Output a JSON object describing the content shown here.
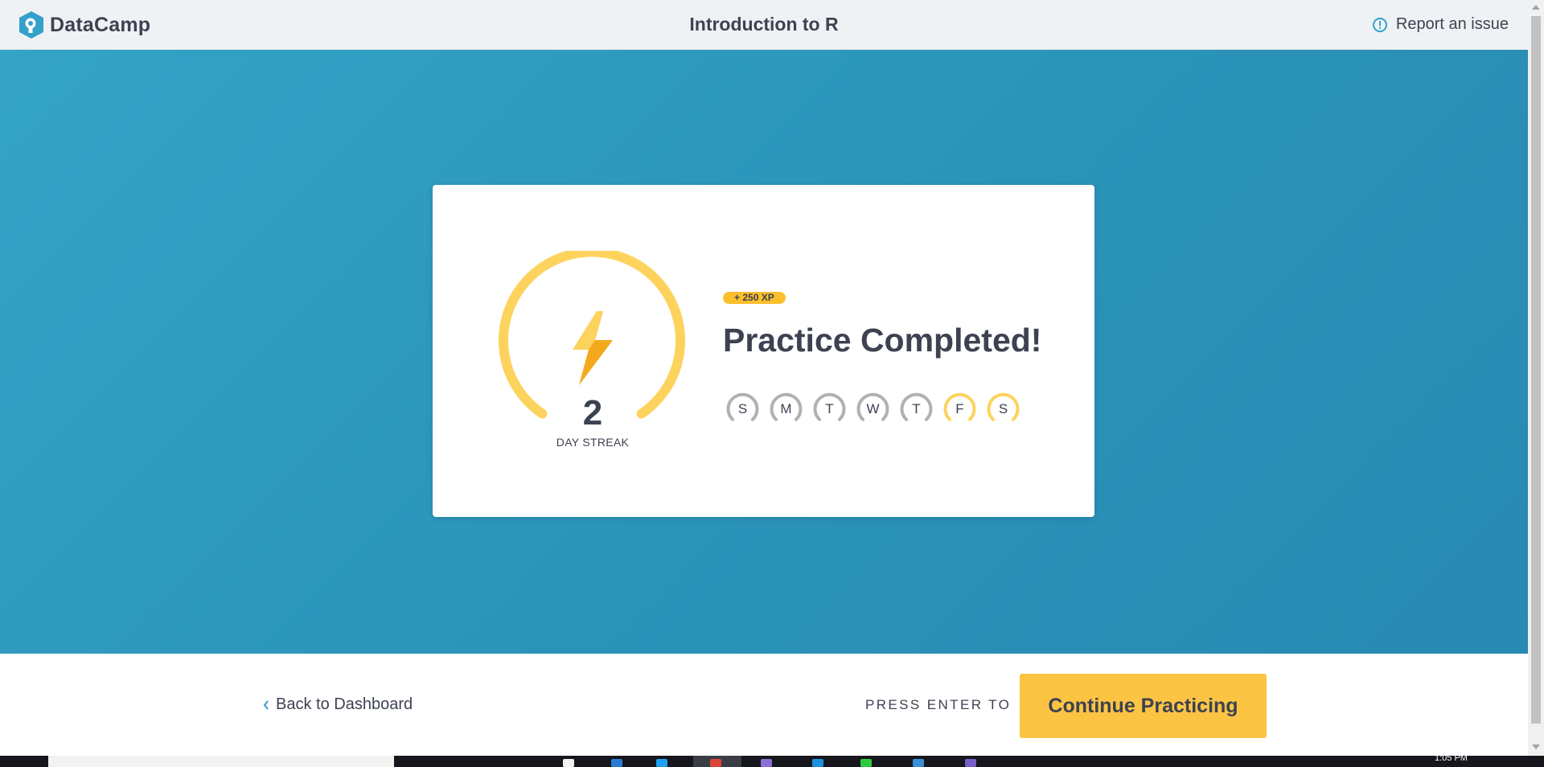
{
  "header": {
    "brand": "DataCamp",
    "title": "Introduction to R",
    "report_label": "Report an issue"
  },
  "card": {
    "streak": {
      "number": "2",
      "label": "DAY STREAK"
    },
    "xp_badge": "+ 250 XP",
    "headline": "Practice Completed!",
    "days": [
      {
        "letter": "S",
        "active": false
      },
      {
        "letter": "M",
        "active": false
      },
      {
        "letter": "T",
        "active": false
      },
      {
        "letter": "W",
        "active": false
      },
      {
        "letter": "T",
        "active": false
      },
      {
        "letter": "F",
        "active": true
      },
      {
        "letter": "S",
        "active": true
      }
    ]
  },
  "footer": {
    "back_label": "Back to Dashboard",
    "press_label": "PRESS ENTER TO",
    "continue_label": "Continue Practicing"
  },
  "taskbar": {
    "clock": "1:05 PM"
  },
  "icons": {
    "brand": "datacamp-logo-icon",
    "report": "alert-circle-icon",
    "back": "chevron-left-icon",
    "streak": "lightning-bolt-icon"
  },
  "colors": {
    "blue": "#2e9cc0",
    "yellow": "#fcc443",
    "ring": "#fdd35e",
    "inactive": "#b1b1b1",
    "text": "#3d4251",
    "accent": "#33a1c9"
  }
}
